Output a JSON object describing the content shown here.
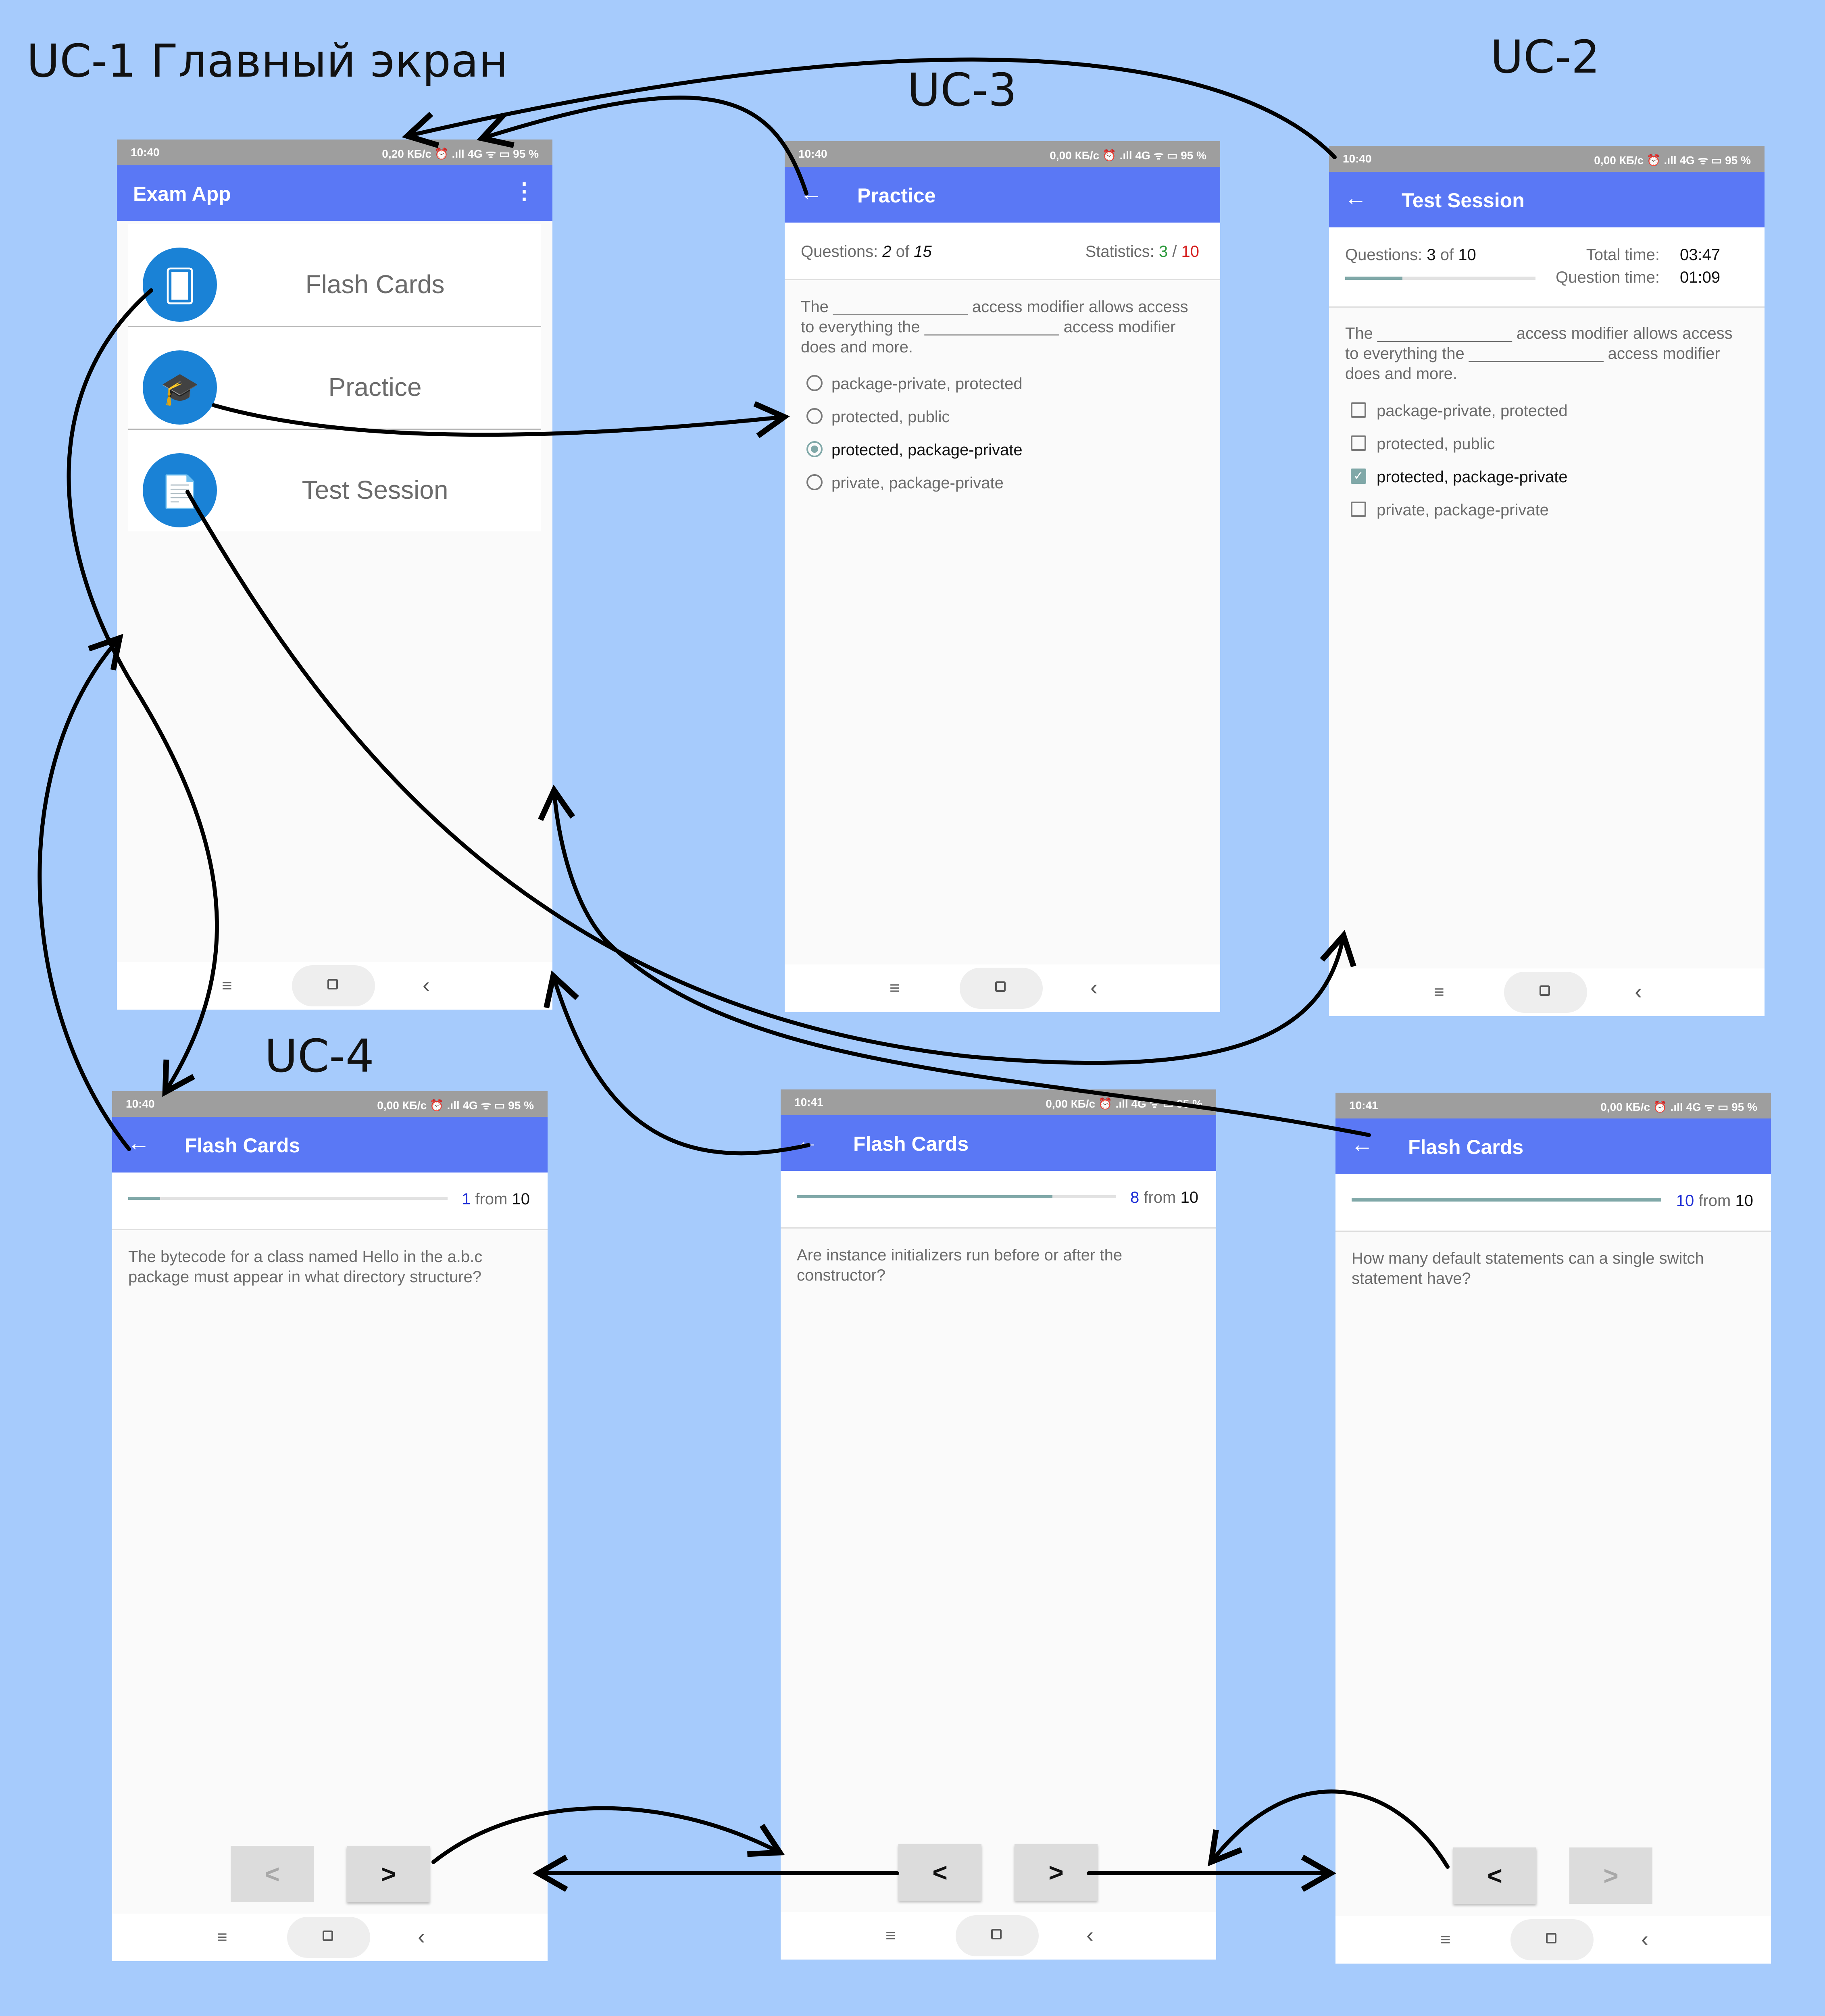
{
  "labels": {
    "uc1": "UC-1 Главный экран",
    "uc2": "UC-2",
    "uc3": "UC-3",
    "uc4": "UC-4"
  },
  "status_bar": {
    "time_1040": "10:40",
    "time_1041": "10:41",
    "info_main": "0,20 КБ/с ⏰ .ıll 4G ᯤ ▭ 95 %",
    "info_other": "0,00 КБ/с ⏰ .ıll 4G ᯤ ▭ 95 %"
  },
  "main_screen": {
    "title": "Exam App",
    "menu_icon": "overflow-menu-icon",
    "items": [
      {
        "label": "Flash Cards",
        "icon": "cards-icon"
      },
      {
        "label": "Practice",
        "icon": "graduation-cap-icon"
      },
      {
        "label": "Test Session",
        "icon": "document-icon"
      }
    ]
  },
  "practice_screen": {
    "title": "Practice",
    "questions_label": "Questions:",
    "current": "2",
    "of": "of",
    "total": "15",
    "statistics_label": "Statistics:",
    "correct": "3",
    "sep": "/",
    "wrong": "10",
    "question": "The _______________ access modifier allows access to everything the _______________ access modifier does and more.",
    "options": [
      "package-private, protected",
      "protected, public",
      "protected, package-private",
      "private, package-private"
    ],
    "selected_index": 2
  },
  "test_screen": {
    "title": "Test Session",
    "questions_label": "Questions:",
    "current": "3",
    "of": "of",
    "total": "10",
    "total_time_label": "Total time:",
    "total_time": "03:47",
    "question_time_label": "Question time:",
    "question_time": "01:09",
    "progress": 0.3,
    "question": "The _______________ access modifier allows access to everything the _______________ access modifier does and more.",
    "options": [
      "package-private, protected",
      "protected, public",
      "protected, package-private",
      "private, package-private"
    ],
    "selected_index": 2
  },
  "flash_cards": [
    {
      "time": "10:40",
      "title": "Flash Cards",
      "current": "1",
      "from": "from",
      "total": "10",
      "progress": 0.1,
      "question": "The bytecode for a class named Hello in the a.b.c package must appear in what directory structure?",
      "prev": "<",
      "next": ">"
    },
    {
      "time": "10:41",
      "title": "Flash Cards",
      "current": "8",
      "from": "from",
      "total": "10",
      "progress": 0.8,
      "question": "Are instance initializers run before or after the constructor?",
      "prev": "<",
      "next": ">"
    },
    {
      "time": "10:41",
      "title": "Flash Cards",
      "current": "10",
      "from": "from",
      "total": "10",
      "progress": 1.0,
      "question": "How many default statements can a single switch statement have?",
      "prev": "<",
      "next": ">"
    }
  ],
  "colors": {
    "background": "#a6cbfc",
    "app_bar": "#5a78f5",
    "status_bar": "#9e9e9e",
    "accent": "#80a8a8",
    "correct": "#2e9a3e",
    "wrong": "#d62020",
    "counter": "#1f2fd6",
    "icon_circle": "#1a82d6"
  }
}
